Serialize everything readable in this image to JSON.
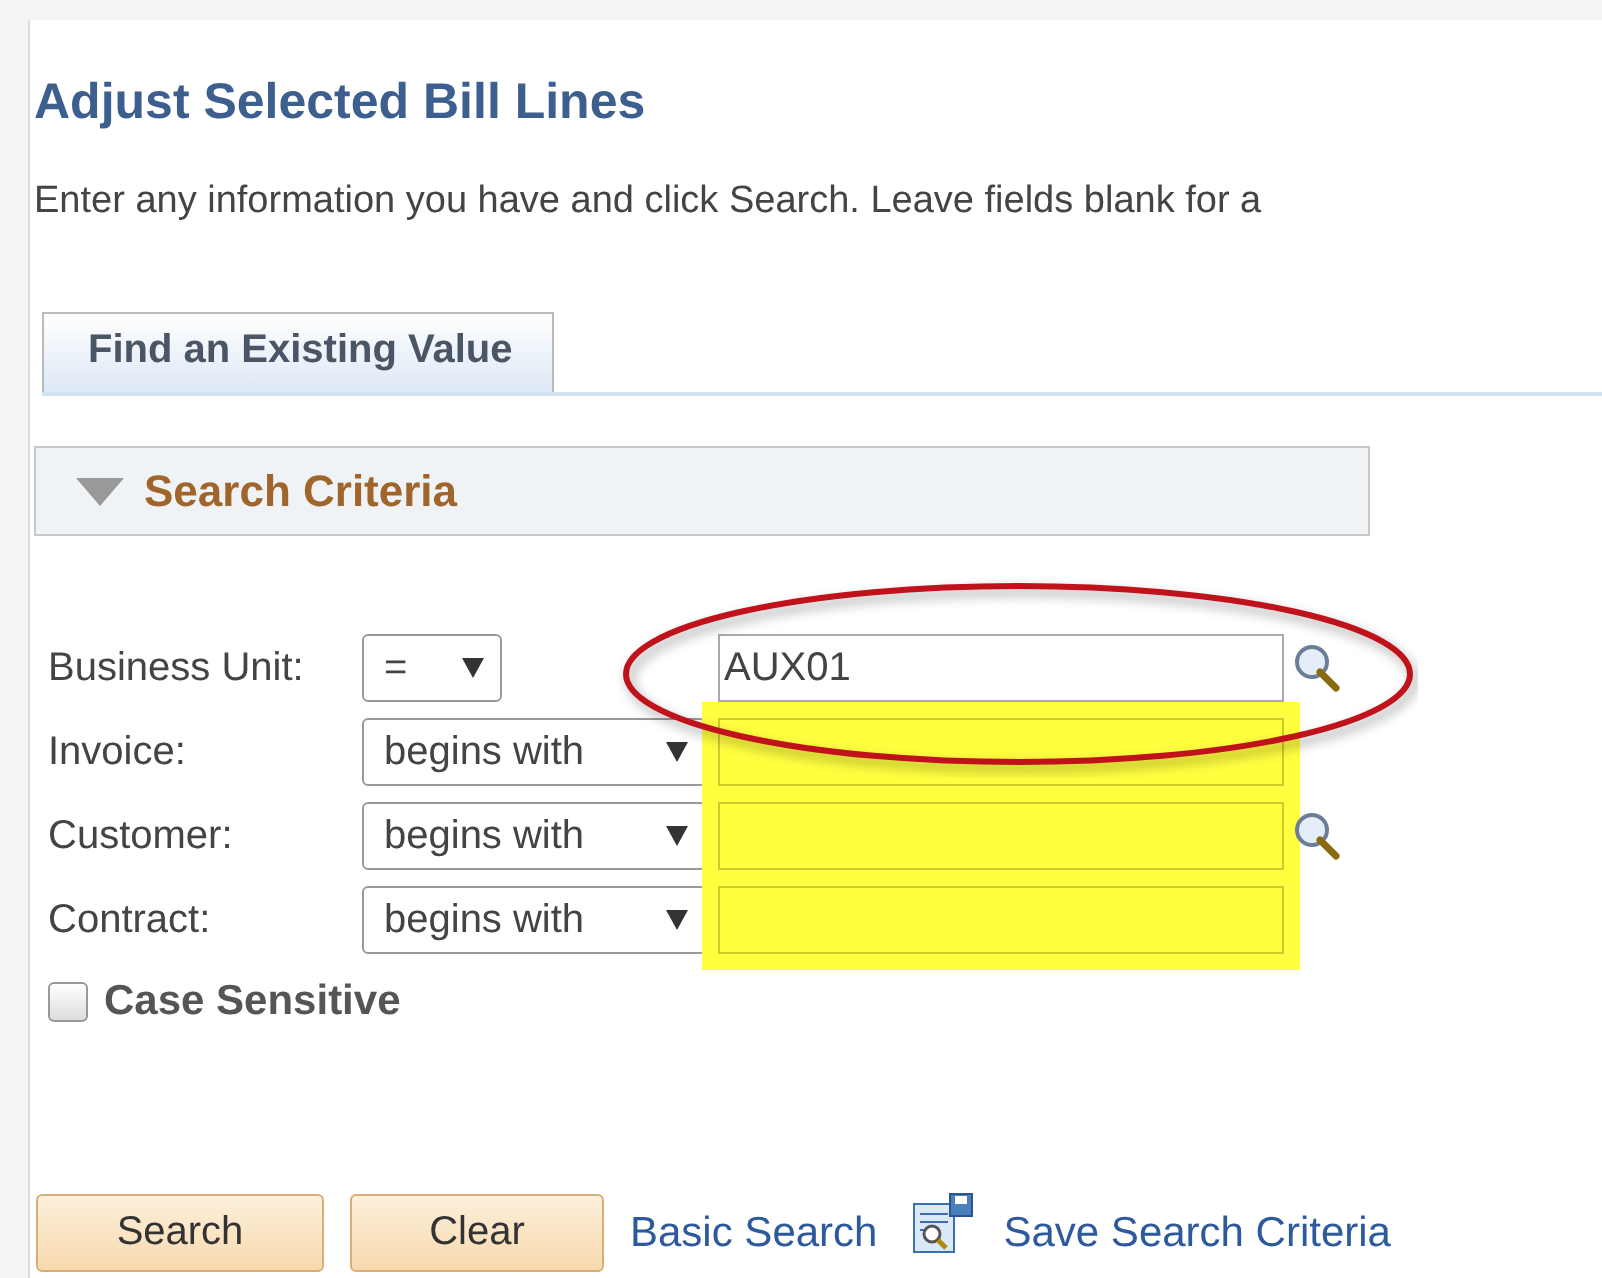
{
  "page": {
    "title": "Adjust Selected Bill Lines",
    "instructions": "Enter any information you have and click Search. Leave fields blank for a"
  },
  "tabs": [
    {
      "label": "Find an Existing Value",
      "selected": true
    }
  ],
  "section": {
    "title": "Search Criteria",
    "expanded": true
  },
  "criteria": [
    {
      "label": "Business Unit:",
      "operator": "=",
      "value": "AUX01",
      "lookup": true,
      "highlighted": false,
      "circled": true
    },
    {
      "label": "Invoice:",
      "operator": "begins with",
      "lookup": false,
      "highlighted": true,
      "circled": false
    },
    {
      "label": "Customer:",
      "operator": "begins with",
      "lookup": true,
      "highlighted": true,
      "circled": false
    },
    {
      "label": "Contract:",
      "operator": "begins with",
      "lookup": false,
      "highlighted": true,
      "circled": false
    }
  ],
  "case_sensitive": {
    "label": "Case Sensitive",
    "checked": false
  },
  "actions": [
    {
      "kind": "button",
      "label": "Search"
    },
    {
      "kind": "button",
      "label": "Clear"
    },
    {
      "kind": "link",
      "label": "Basic Search"
    },
    {
      "kind": "icon-link",
      "label": "Save Search Criteria"
    }
  ]
}
